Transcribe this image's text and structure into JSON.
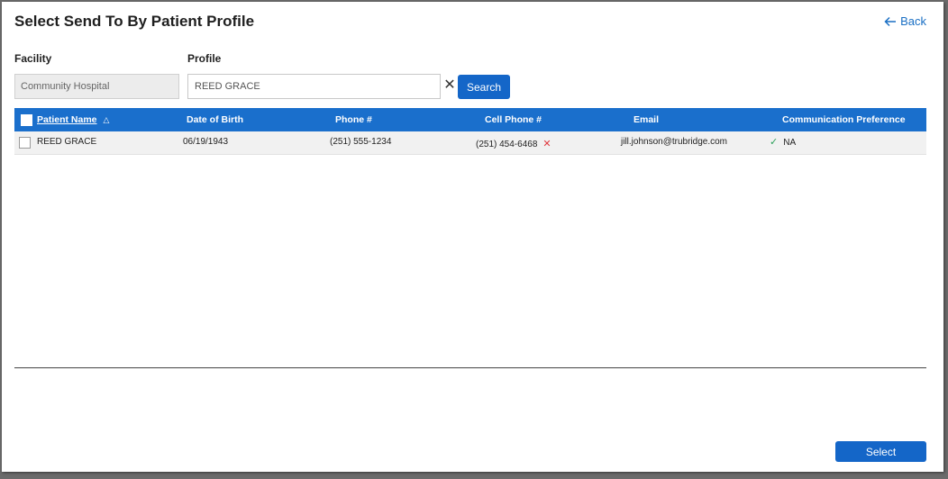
{
  "dialog": {
    "title": "Select Send To By Patient Profile",
    "back_label": "Back"
  },
  "filters": {
    "facility_label": "Facility",
    "facility_value": "Community Hospital",
    "profile_label": "Profile",
    "profile_value": "REED GRACE",
    "search_label": "Search"
  },
  "table": {
    "columns": [
      "Patient Name",
      "Date of Birth",
      "Phone #",
      "Cell Phone #",
      "Email",
      "Communication Preference"
    ],
    "sort": "ascending",
    "rows": [
      {
        "name": "REED GRACE",
        "dob": "06/19/1943",
        "phone": "(251) 555-1234",
        "cell": "(251) 454-6468",
        "cell_status": "invalid",
        "email": "jill.johnson@trubridge.com",
        "email_status": "valid",
        "preference": "NA"
      }
    ]
  },
  "footer": {
    "select_label": "Select"
  },
  "colors": {
    "accent": "#1466c8",
    "header_bg": "#1a6fcc",
    "error": "#e0383e",
    "success": "#2ca05a"
  }
}
